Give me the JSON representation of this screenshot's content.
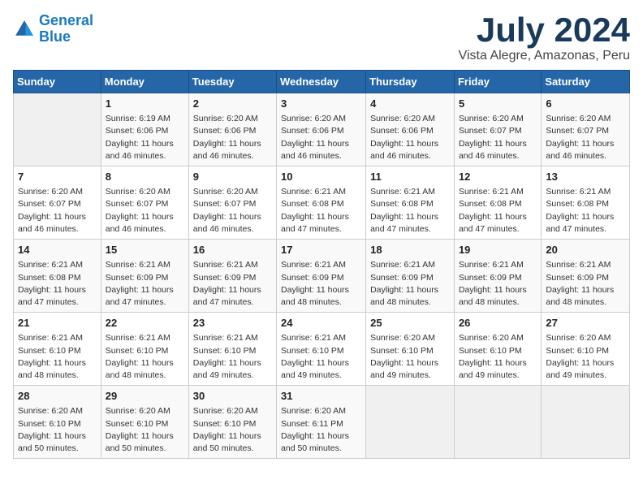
{
  "logo": {
    "line1": "General",
    "line2": "Blue"
  },
  "title": "July 2024",
  "subtitle": "Vista Alegre, Amazonas, Peru",
  "headers": [
    "Sunday",
    "Monday",
    "Tuesday",
    "Wednesday",
    "Thursday",
    "Friday",
    "Saturday"
  ],
  "weeks": [
    [
      {
        "day": "",
        "info": ""
      },
      {
        "day": "1",
        "info": "Sunrise: 6:19 AM\nSunset: 6:06 PM\nDaylight: 11 hours\nand 46 minutes."
      },
      {
        "day": "2",
        "info": "Sunrise: 6:20 AM\nSunset: 6:06 PM\nDaylight: 11 hours\nand 46 minutes."
      },
      {
        "day": "3",
        "info": "Sunrise: 6:20 AM\nSunset: 6:06 PM\nDaylight: 11 hours\nand 46 minutes."
      },
      {
        "day": "4",
        "info": "Sunrise: 6:20 AM\nSunset: 6:06 PM\nDaylight: 11 hours\nand 46 minutes."
      },
      {
        "day": "5",
        "info": "Sunrise: 6:20 AM\nSunset: 6:07 PM\nDaylight: 11 hours\nand 46 minutes."
      },
      {
        "day": "6",
        "info": "Sunrise: 6:20 AM\nSunset: 6:07 PM\nDaylight: 11 hours\nand 46 minutes."
      }
    ],
    [
      {
        "day": "7",
        "info": "Sunrise: 6:20 AM\nSunset: 6:07 PM\nDaylight: 11 hours\nand 46 minutes."
      },
      {
        "day": "8",
        "info": "Sunrise: 6:20 AM\nSunset: 6:07 PM\nDaylight: 11 hours\nand 46 minutes."
      },
      {
        "day": "9",
        "info": "Sunrise: 6:20 AM\nSunset: 6:07 PM\nDaylight: 11 hours\nand 46 minutes."
      },
      {
        "day": "10",
        "info": "Sunrise: 6:21 AM\nSunset: 6:08 PM\nDaylight: 11 hours\nand 47 minutes."
      },
      {
        "day": "11",
        "info": "Sunrise: 6:21 AM\nSunset: 6:08 PM\nDaylight: 11 hours\nand 47 minutes."
      },
      {
        "day": "12",
        "info": "Sunrise: 6:21 AM\nSunset: 6:08 PM\nDaylight: 11 hours\nand 47 minutes."
      },
      {
        "day": "13",
        "info": "Sunrise: 6:21 AM\nSunset: 6:08 PM\nDaylight: 11 hours\nand 47 minutes."
      }
    ],
    [
      {
        "day": "14",
        "info": "Sunrise: 6:21 AM\nSunset: 6:08 PM\nDaylight: 11 hours\nand 47 minutes."
      },
      {
        "day": "15",
        "info": "Sunrise: 6:21 AM\nSunset: 6:09 PM\nDaylight: 11 hours\nand 47 minutes."
      },
      {
        "day": "16",
        "info": "Sunrise: 6:21 AM\nSunset: 6:09 PM\nDaylight: 11 hours\nand 47 minutes."
      },
      {
        "day": "17",
        "info": "Sunrise: 6:21 AM\nSunset: 6:09 PM\nDaylight: 11 hours\nand 48 minutes."
      },
      {
        "day": "18",
        "info": "Sunrise: 6:21 AM\nSunset: 6:09 PM\nDaylight: 11 hours\nand 48 minutes."
      },
      {
        "day": "19",
        "info": "Sunrise: 6:21 AM\nSunset: 6:09 PM\nDaylight: 11 hours\nand 48 minutes."
      },
      {
        "day": "20",
        "info": "Sunrise: 6:21 AM\nSunset: 6:09 PM\nDaylight: 11 hours\nand 48 minutes."
      }
    ],
    [
      {
        "day": "21",
        "info": "Sunrise: 6:21 AM\nSunset: 6:10 PM\nDaylight: 11 hours\nand 48 minutes."
      },
      {
        "day": "22",
        "info": "Sunrise: 6:21 AM\nSunset: 6:10 PM\nDaylight: 11 hours\nand 48 minutes."
      },
      {
        "day": "23",
        "info": "Sunrise: 6:21 AM\nSunset: 6:10 PM\nDaylight: 11 hours\nand 49 minutes."
      },
      {
        "day": "24",
        "info": "Sunrise: 6:21 AM\nSunset: 6:10 PM\nDaylight: 11 hours\nand 49 minutes."
      },
      {
        "day": "25",
        "info": "Sunrise: 6:20 AM\nSunset: 6:10 PM\nDaylight: 11 hours\nand 49 minutes."
      },
      {
        "day": "26",
        "info": "Sunrise: 6:20 AM\nSunset: 6:10 PM\nDaylight: 11 hours\nand 49 minutes."
      },
      {
        "day": "27",
        "info": "Sunrise: 6:20 AM\nSunset: 6:10 PM\nDaylight: 11 hours\nand 49 minutes."
      }
    ],
    [
      {
        "day": "28",
        "info": "Sunrise: 6:20 AM\nSunset: 6:10 PM\nDaylight: 11 hours\nand 50 minutes."
      },
      {
        "day": "29",
        "info": "Sunrise: 6:20 AM\nSunset: 6:10 PM\nDaylight: 11 hours\nand 50 minutes."
      },
      {
        "day": "30",
        "info": "Sunrise: 6:20 AM\nSunset: 6:10 PM\nDaylight: 11 hours\nand 50 minutes."
      },
      {
        "day": "31",
        "info": "Sunrise: 6:20 AM\nSunset: 6:11 PM\nDaylight: 11 hours\nand 50 minutes."
      },
      {
        "day": "",
        "info": ""
      },
      {
        "day": "",
        "info": ""
      },
      {
        "day": "",
        "info": ""
      }
    ]
  ]
}
